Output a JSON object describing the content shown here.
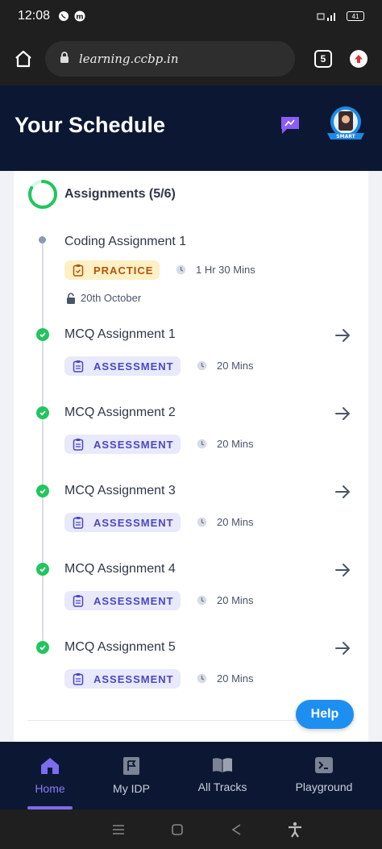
{
  "status_bar": {
    "time": "12:08",
    "battery": "41"
  },
  "browser": {
    "url": "learning.ccbp.in",
    "tab_count": "5"
  },
  "header": {
    "title": "Your Schedule",
    "avatar_label": "SMART"
  },
  "section": {
    "title": "Assignments (5/6)",
    "completed": 5,
    "total": 6
  },
  "items": [
    {
      "title": "Coding Assignment 1",
      "type": "PRACTICE",
      "duration": "1 Hr 30 Mins",
      "unlock_date": "20th October",
      "status": "locked"
    },
    {
      "title": "MCQ Assignment 1",
      "type": "ASSESSMENT",
      "duration": "20 Mins",
      "status": "completed"
    },
    {
      "title": "MCQ Assignment 2",
      "type": "ASSESSMENT",
      "duration": "20 Mins",
      "status": "completed"
    },
    {
      "title": "MCQ Assignment 3",
      "type": "ASSESSMENT",
      "duration": "20 Mins",
      "status": "completed"
    },
    {
      "title": "MCQ Assignment 4",
      "type": "ASSESSMENT",
      "duration": "20 Mins",
      "status": "completed"
    },
    {
      "title": "MCQ Assignment 5",
      "type": "ASSESSMENT",
      "duration": "20 Mins",
      "status": "completed"
    }
  ],
  "help": {
    "label": "Help"
  },
  "nav": [
    {
      "label": "Home",
      "icon": "home-icon",
      "active": true
    },
    {
      "label": "My IDP",
      "icon": "flag-document-icon",
      "active": false
    },
    {
      "label": "All Tracks",
      "icon": "book-icon",
      "active": false
    },
    {
      "label": "Playground",
      "icon": "terminal-icon",
      "active": false
    }
  ],
  "colors": {
    "header_bg": "#0c1833",
    "success": "#22c55e",
    "accent": "#7c6cf0",
    "help": "#1d8ff1"
  }
}
